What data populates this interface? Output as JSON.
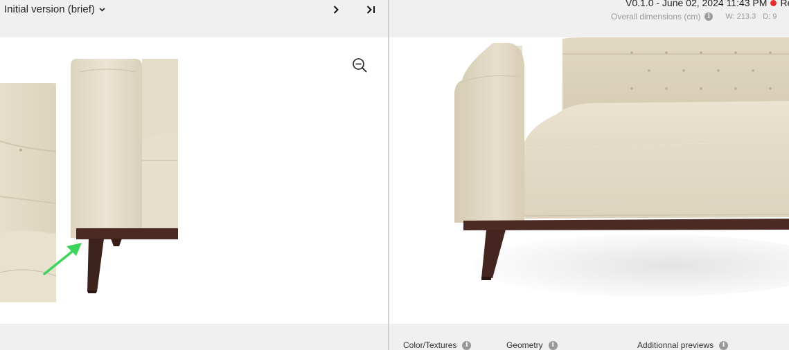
{
  "left_pane": {
    "version_dropdown": {
      "label": "Initial version (brief)",
      "icon": "chevron-down-icon"
    },
    "nav": {
      "next_icon": "chevron-right-icon",
      "last_icon": "skip-to-end-icon"
    },
    "zoom_icon": "zoom-out-icon",
    "annotation_color": "#3dd35c"
  },
  "right_pane": {
    "version_text": "V0.1.0 - June 02, 2024 11:43 PM",
    "status_label": "Re",
    "status_color": "#e53030",
    "dimensions_label": "Overall dimensions (cm)",
    "dim_w": "W: 213.3",
    "dim_d": "D: 9",
    "tabs": [
      {
        "label": "Color/Textures"
      },
      {
        "label": "Geometry"
      },
      {
        "label": "Additionnal previews"
      }
    ]
  },
  "colors": {
    "fabric": "#e8e0cd",
    "wood": "#4a2a22",
    "panel_bg": "#f0f0f0"
  }
}
